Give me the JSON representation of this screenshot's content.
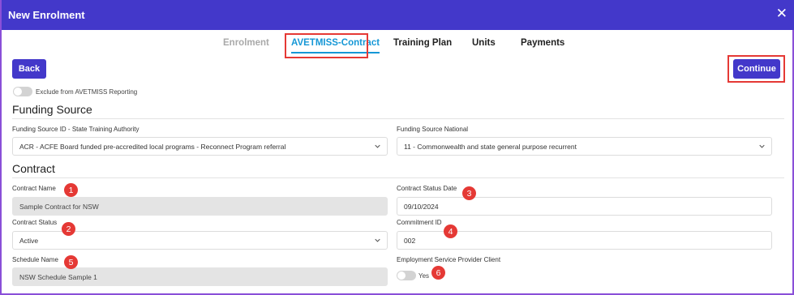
{
  "window": {
    "title": "New Enrolment",
    "close_glyph": "✕"
  },
  "tabs": [
    {
      "label": "Enrolment",
      "state": "disabled"
    },
    {
      "label": "AVETMISS-Contract",
      "state": "active"
    },
    {
      "label": "Training Plan",
      "state": "normal"
    },
    {
      "label": "Units",
      "state": "normal"
    },
    {
      "label": "Payments",
      "state": "normal"
    }
  ],
  "actions": {
    "back_label": "Back",
    "continue_label": "Continue"
  },
  "exclude_toggle": {
    "label": "Exclude from AVETMISS Reporting",
    "on": false
  },
  "funding": {
    "heading": "Funding Source",
    "state_label": "Funding Source ID - State Training Authority",
    "state_value": "ACR - ACFE Board funded pre-accredited local programs - Reconnect Program referral",
    "national_label": "Funding Source National",
    "national_value": "11 - Commonwealth and state general purpose recurrent"
  },
  "contract": {
    "heading": "Contract",
    "name_label": "Contract Name",
    "name_value": "Sample Contract for NSW",
    "status_date_label": "Contract Status Date",
    "status_date_value": "09/10/2024",
    "status_label": "Contract Status",
    "status_value": "Active",
    "commitment_label": "Commitment ID",
    "commitment_value": "002",
    "schedule_label": "Schedule Name",
    "schedule_value": "NSW Schedule Sample 1",
    "esp_label": "Employment Service Provider Client",
    "esp_toggle_label": "Yes",
    "esp_on": false
  },
  "markers": [
    "1",
    "2",
    "3",
    "4",
    "5",
    "6"
  ],
  "colors": {
    "header": "#4338ca",
    "active_tab": "#1597d6",
    "highlight": "#e53935"
  }
}
